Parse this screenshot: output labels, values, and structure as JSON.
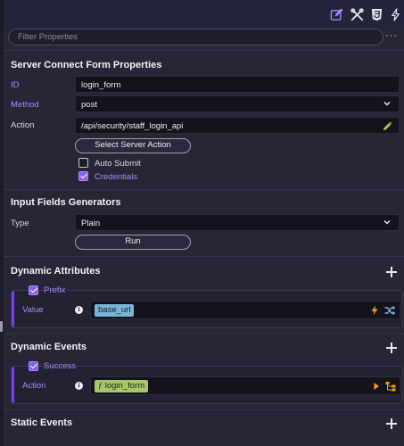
{
  "toolbar": {
    "icons": [
      "edit-icon",
      "tools-icon",
      "css3-icon",
      "flash-icon"
    ]
  },
  "filter": {
    "placeholder": "Filter Properties",
    "more_label": "···"
  },
  "form_properties": {
    "title": "Server Connect Form Properties",
    "id_label": "ID",
    "id_value": "login_form",
    "method_label": "Method",
    "method_value": "post",
    "action_label": "Action",
    "action_value": "/api/security/staff_login_api",
    "select_action_label": "Select Server Action",
    "auto_submit_label": "Auto Submit",
    "auto_submit_checked": false,
    "credentials_label": "Credentials",
    "credentials_checked": true
  },
  "input_generators": {
    "title": "Input Fields Generators",
    "type_label": "Type",
    "type_value": "Plain",
    "run_label": "Run"
  },
  "dynamic_attributes": {
    "title": "Dynamic Attributes",
    "group_title": "Prefix",
    "value_label": "Value",
    "value_chip": "base_url"
  },
  "dynamic_events": {
    "title": "Dynamic Events",
    "group_title": "Success",
    "action_label": "Action",
    "action_chip_prefix": "ƒ",
    "action_chip": "login_form"
  },
  "static_events": {
    "title": "Static Events"
  },
  "colors": {
    "accent": "#a78bfa",
    "background": "#262636",
    "field": "#13131c",
    "chip_blue": "#7ab4d6",
    "chip_green": "#a8c66a",
    "flash_orange": "#f59e0b"
  }
}
